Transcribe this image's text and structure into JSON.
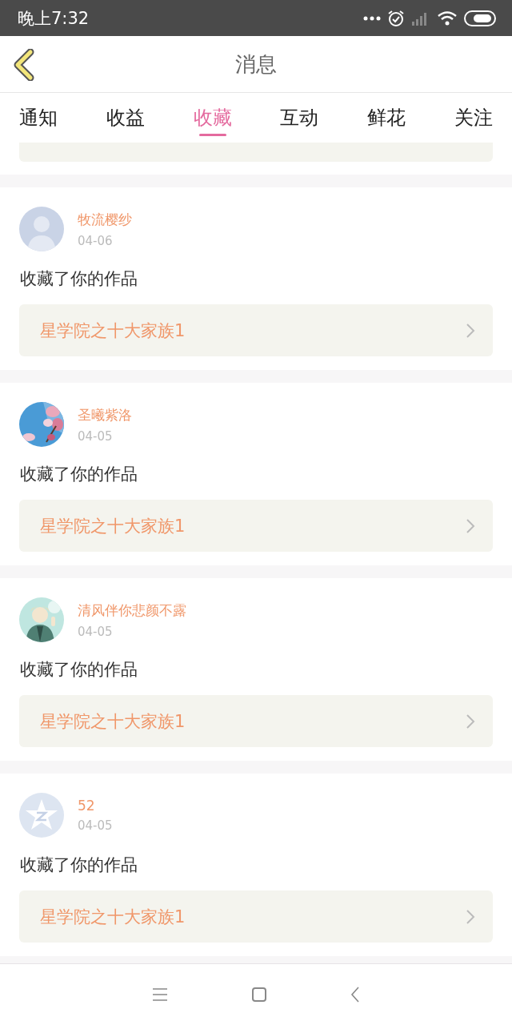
{
  "status_bar": {
    "time": "晚上7:32"
  },
  "header": {
    "title": "消息"
  },
  "tabs": [
    {
      "label": "通知",
      "selected": false
    },
    {
      "label": "收益",
      "selected": false
    },
    {
      "label": "收藏",
      "selected": true
    },
    {
      "label": "互动",
      "selected": false
    },
    {
      "label": "鲜花",
      "selected": false
    },
    {
      "label": "关注",
      "selected": false
    }
  ],
  "items": [
    {
      "kind": "cut"
    },
    {
      "kind": "full",
      "avatar": {
        "kind": "default"
      },
      "name": "牧流樱纱",
      "date": "04-06",
      "action": "收藏了你的作品",
      "work": "星学院之十大家族1"
    },
    {
      "kind": "full",
      "avatar": {
        "kind": "flowers"
      },
      "name": "圣曦紫洛",
      "date": "04-05",
      "action": "收藏了你的作品",
      "work": "星学院之十大家族1"
    },
    {
      "kind": "full",
      "avatar": {
        "kind": "figure"
      },
      "name": "清风伴你悲颜不露",
      "date": "04-05",
      "action": "收藏了你的作品",
      "work": "星学院之十大家族1"
    },
    {
      "kind": "full",
      "avatar": {
        "kind": "star"
      },
      "name": "52",
      "date": "04-05",
      "action": "收藏了你的作品",
      "work": "星学院之十大家族1"
    }
  ]
}
